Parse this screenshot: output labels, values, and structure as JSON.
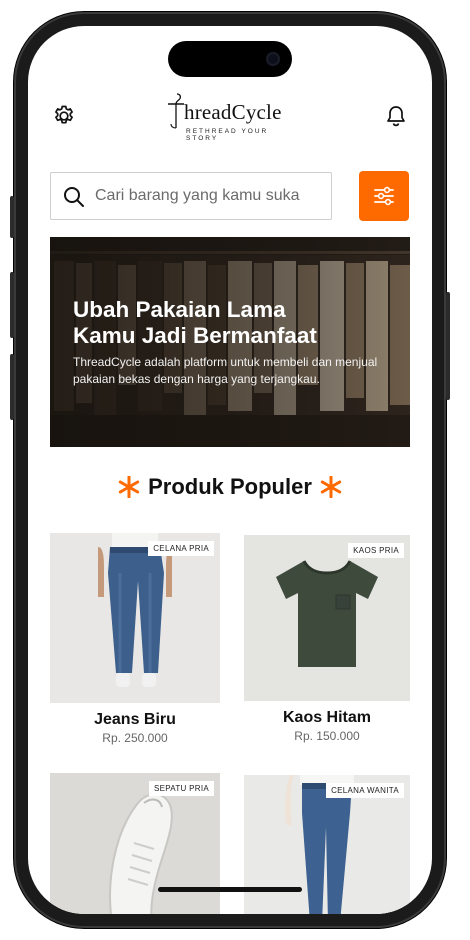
{
  "app": {
    "logo_text": "hreadCycle",
    "tagline": "RETHREAD YOUR STORY"
  },
  "header": {
    "settings_icon": "gear-icon",
    "notification_icon": "bell-icon"
  },
  "search": {
    "placeholder": "Cari barang yang kamu suka",
    "icon": "search-icon",
    "filter_icon": "sliders-icon"
  },
  "banner": {
    "title_line1": "Ubah Pakaian Lama",
    "title_line2": "Kamu Jadi Bermanfaat",
    "description": "ThreadCycle adalah platform untuk membeli dan menjual pakaian bekas dengan harga yang terjangkau."
  },
  "section": {
    "title": "Produk Populer"
  },
  "products": [
    {
      "tag": "CELANA PRIA",
      "name": "Jeans Biru",
      "price": "Rp. 250.000"
    },
    {
      "tag": "KAOS  PRIA",
      "name": "Kaos Hitam",
      "price": "Rp. 150.000"
    },
    {
      "tag": "SEPATU PRIA",
      "name": "",
      "price": ""
    },
    {
      "tag": "CELANA WANITA",
      "name": "",
      "price": ""
    }
  ],
  "colors": {
    "accent": "#ff6a00",
    "text": "#111111",
    "muted": "#666666"
  }
}
